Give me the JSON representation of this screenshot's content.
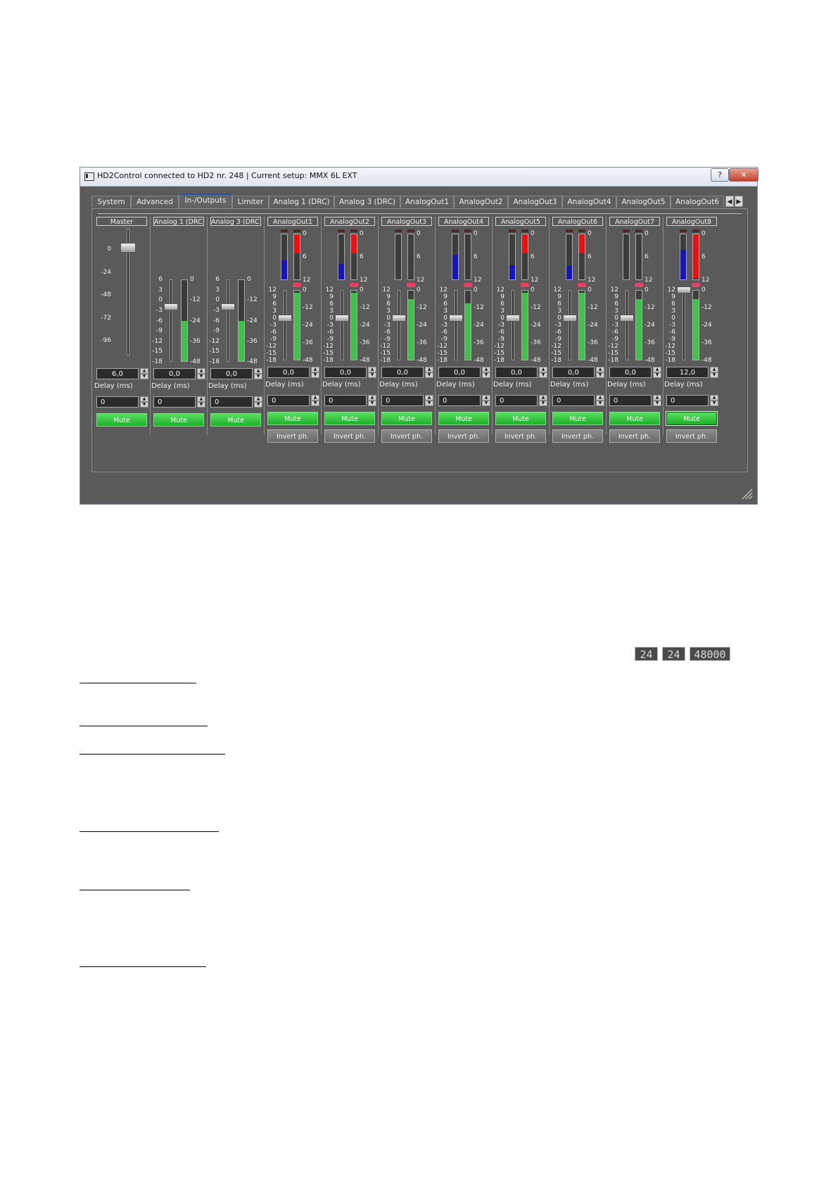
{
  "window": {
    "title": "HD2Control connected to HD2 nr. 248 | Current setup: MMX 6L EXT",
    "help_label": "?",
    "close_label": "✕"
  },
  "tabs": [
    {
      "label": "System",
      "active": false
    },
    {
      "label": "Advanced",
      "active": false
    },
    {
      "label": "In-/Outputs",
      "active": true
    },
    {
      "label": "Limiter",
      "active": false
    },
    {
      "label": "Analog 1 (DRC)",
      "active": false
    },
    {
      "label": "Analog 3 (DRC)",
      "active": false
    },
    {
      "label": "AnalogOut1",
      "active": false
    },
    {
      "label": "AnalogOut2",
      "active": false
    },
    {
      "label": "AnalogOut3",
      "active": false
    },
    {
      "label": "AnalogOut4",
      "active": false
    },
    {
      "label": "AnalogOut5",
      "active": false
    },
    {
      "label": "AnalogOut6",
      "active": false
    }
  ],
  "tab_scroll": {
    "left_icon": "chevron-left-icon",
    "right_icon": "chevron-right-icon",
    "left_glyph": "◀",
    "right_glyph": "▶"
  },
  "scales": {
    "master": [
      "0",
      "-24",
      "-48",
      "-72",
      "-96"
    ],
    "gain": [
      "6",
      "3",
      "0",
      "-3",
      "-6",
      "-9",
      "-12",
      "-15",
      "-18"
    ],
    "out_gain": [
      "12",
      "9",
      "6",
      "3",
      "0",
      "-3",
      "-6",
      "-9",
      "-12",
      "-15",
      "-18"
    ],
    "level": [
      "0",
      "-12",
      "-24",
      "-36",
      "-48"
    ],
    "limiter": [
      "0",
      "6",
      "12"
    ]
  },
  "labels": {
    "delay": "Delay (ms)",
    "mute": "Mute",
    "invert": "Invert ph."
  },
  "strips": {
    "master": {
      "name": "Master",
      "value": "6,0",
      "delay": "0",
      "fader_level": 0.85
    },
    "inputs": [
      {
        "name": "Analog 1 (DRC)",
        "value": "0,0",
        "delay": "0",
        "fader_level": 0.67,
        "meter_level": 0.5
      },
      {
        "name": "Analog 3 (DRC)",
        "value": "0,0",
        "delay": "0",
        "fader_level": 0.67,
        "meter_level": 0.5
      }
    ],
    "outputs": [
      {
        "name": "AnalogOut1",
        "value": "0,0",
        "delay": "0",
        "fader_level": 0.6,
        "meter_level": 0.97,
        "limiter_level": 0.42,
        "red_level": 0.42
      },
      {
        "name": "AnalogOut2",
        "value": "0,0",
        "delay": "0",
        "fader_level": 0.6,
        "meter_level": 0.97,
        "limiter_level": 0.35,
        "red_level": 0.42
      },
      {
        "name": "AnalogOut3",
        "value": "0,0",
        "delay": "0",
        "fader_level": 0.6,
        "meter_level": 0.88,
        "limiter_level": 0.0,
        "red_level": 0.0
      },
      {
        "name": "AnalogOut4",
        "value": "0,0",
        "delay": "0",
        "fader_level": 0.6,
        "meter_level": 0.82,
        "limiter_level": 0.55,
        "red_level": 0.0
      },
      {
        "name": "AnalogOut5",
        "value": "0,0",
        "delay": "0",
        "fader_level": 0.6,
        "meter_level": 0.97,
        "limiter_level": 0.32,
        "red_level": 0.42
      },
      {
        "name": "AnalogOut6",
        "value": "0,0",
        "delay": "0",
        "fader_level": 0.6,
        "meter_level": 0.97,
        "limiter_level": 0.3,
        "red_level": 0.42
      },
      {
        "name": "AnalogOut7",
        "value": "0,0",
        "delay": "0",
        "fader_level": 0.6,
        "meter_level": 0.88,
        "limiter_level": 0.0,
        "red_level": 0.0
      },
      {
        "name": "AnalogOut8",
        "value": "12,0",
        "delay": "0",
        "fader_level": 1.0,
        "meter_level": 0.88,
        "limiter_level": 0.65,
        "red_level": 0.97
      }
    ]
  },
  "status": {
    "lcd1": "24",
    "lcd2": "24",
    "lcd3": "48000"
  },
  "colors": {
    "meter_green": "#3fc24a",
    "meter_blue": "#1616b8",
    "meter_red": "#ee1010",
    "mute_green": "#2ec236"
  }
}
